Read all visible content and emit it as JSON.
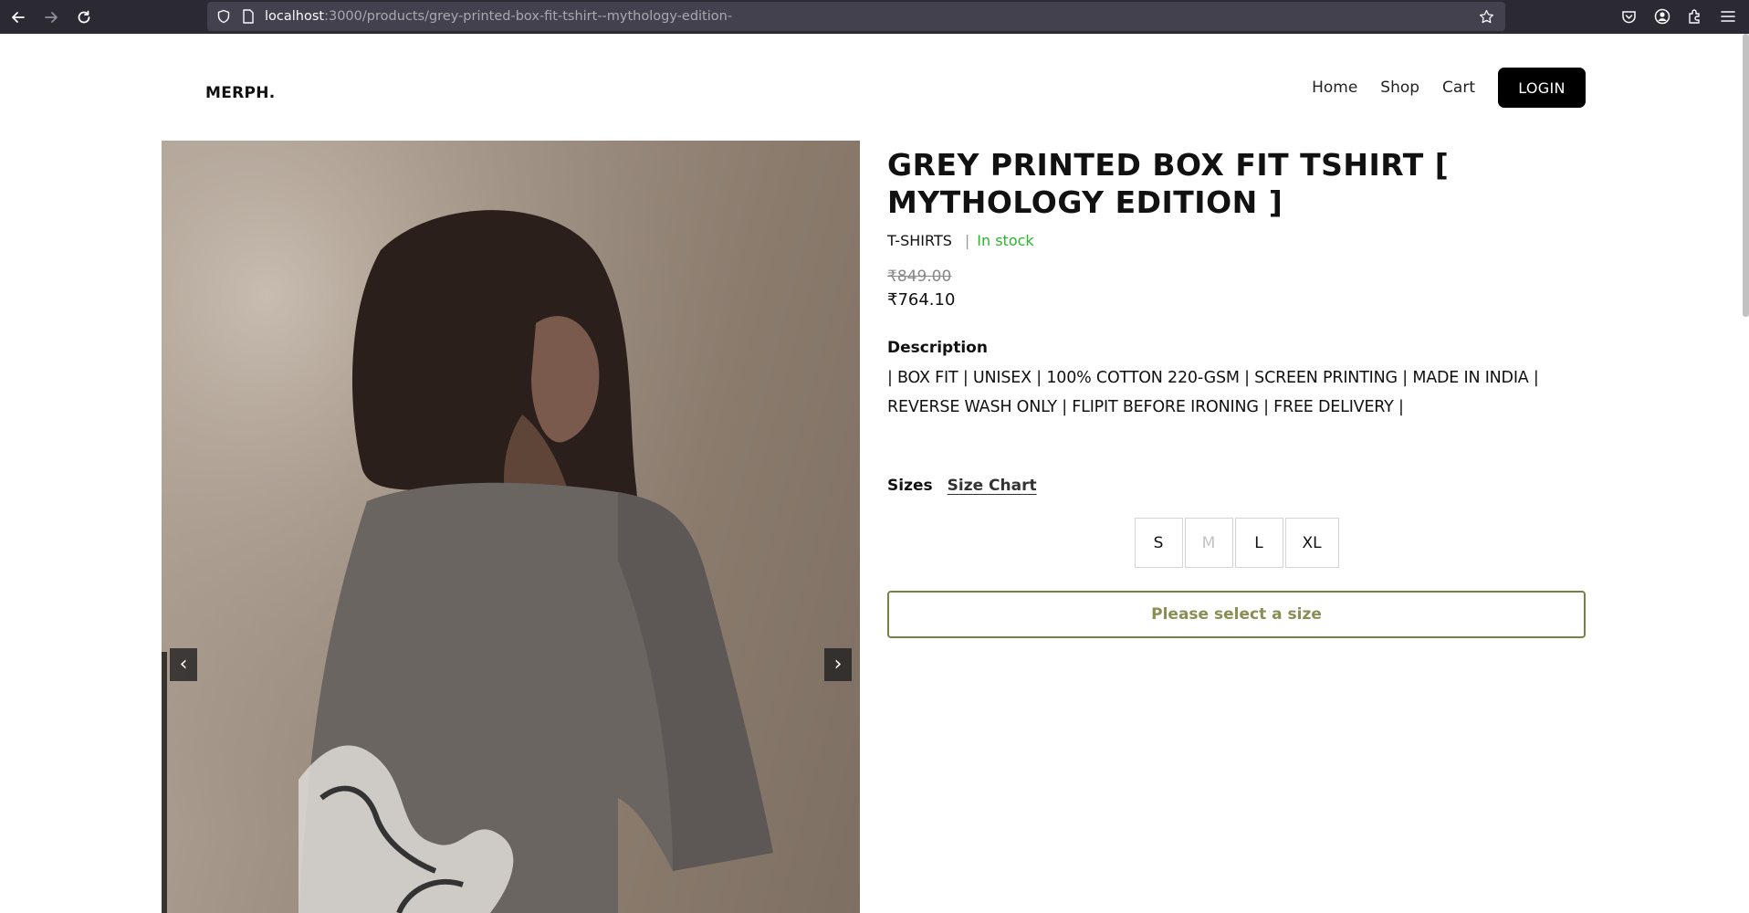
{
  "browser": {
    "url_host": "localhost",
    "url_path": ":3000/products/grey-printed-box-fit-tshirt--mythology-edition-",
    "icons": [
      "back-arrow-icon",
      "forward-arrow-icon",
      "reload-icon",
      "shield-icon",
      "page-icon",
      "star-icon",
      "pocket-icon",
      "account-icon",
      "extensions-icon",
      "menu-icon"
    ]
  },
  "header": {
    "logo": "MERPH.",
    "nav": {
      "home": "Home",
      "shop": "Shop",
      "cart": "Cart"
    },
    "login_label": "LOGIN"
  },
  "carousel": {
    "prev_label": "‹",
    "next_label": "›"
  },
  "product": {
    "title": "GREY PRINTED BOX FIT TSHIRT [ MYTHOLOGY EDITION ]",
    "category": "T-SHIRTS",
    "separator": "|",
    "stock": "In stock",
    "stock_color": "#2cb52c",
    "original_price": "₹849.00",
    "price": "₹764.10",
    "description_heading": "Description",
    "description": "| BOX FIT | UNISEX | 100% COTTON 220-GSM | SCREEN PRINTING | MADE IN INDIA | REVERSE WASH ONLY | FLIPIT BEFORE IRONING | FREE DELIVERY |",
    "sizes_label": "Sizes",
    "size_chart_label": "Size Chart",
    "sizes": [
      {
        "label": "S",
        "available": true
      },
      {
        "label": "M",
        "available": false
      },
      {
        "label": "L",
        "available": true
      },
      {
        "label": "XL",
        "available": true
      }
    ],
    "cta_label": "Please select a size",
    "cta_color": "#7a8044"
  }
}
